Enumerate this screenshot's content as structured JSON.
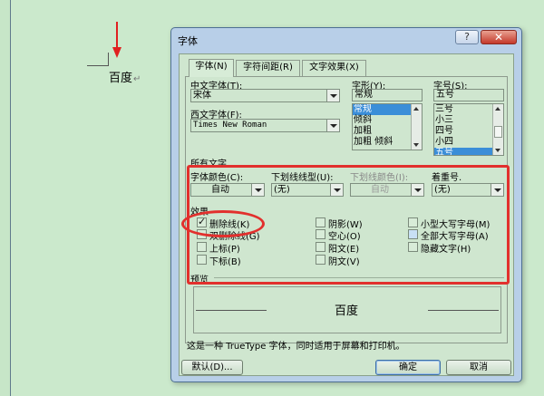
{
  "document": {
    "text": "百度",
    "return_mark": "↵"
  },
  "dialog": {
    "title": "字体",
    "help_label": "?",
    "close_label": "✕",
    "tabs": [
      {
        "label": "字体(N)",
        "active": true
      },
      {
        "label": "字符间距(R)",
        "active": false
      },
      {
        "label": "文字效果(X)",
        "active": false
      }
    ],
    "chinese_font": {
      "label": "中文字体(T):",
      "value": "宋体"
    },
    "western_font": {
      "label": "西文字体(F):",
      "value": "Times New Roman"
    },
    "font_style": {
      "label": "字形(Y):",
      "value": "常规",
      "options": [
        "常规",
        "倾斜",
        "加粗",
        "加粗 倾斜"
      ],
      "selected_index": 0
    },
    "font_size": {
      "label": "字号(S):",
      "value": "五号",
      "options": [
        "三号",
        "小三",
        "四号",
        "小四",
        "五号"
      ],
      "selected_index": 4
    },
    "all_text_title": "所有文字",
    "font_color": {
      "label": "字体颜色(C):",
      "value": "自动"
    },
    "underline_type": {
      "label": "下划线线型(U):",
      "value": "(无)"
    },
    "underline_color": {
      "label": "下划线颜色(I):",
      "value": "自动"
    },
    "emphasis_mark": {
      "label": "着重号.",
      "value": "(无)"
    },
    "effects_title": "效果",
    "effects": {
      "strikethrough": {
        "label": "删除线(K)",
        "checked": true
      },
      "double_strikethrough": {
        "label": "双删除线(G)",
        "checked": false
      },
      "superscript": {
        "label": "上标(P)",
        "checked": false
      },
      "subscript": {
        "label": "下标(B)",
        "checked": false
      },
      "shadow": {
        "label": "阴影(W)",
        "checked": false
      },
      "outline": {
        "label": "空心(O)",
        "checked": false
      },
      "emboss": {
        "label": "阳文(E)",
        "checked": false
      },
      "engrave": {
        "label": "阴文(V)",
        "checked": false
      },
      "small_caps": {
        "label": "小型大写字母(M)",
        "checked": false
      },
      "all_caps": {
        "label": "全部大写字母(A)",
        "checked": false
      },
      "hidden": {
        "label": "隐藏文字(H)",
        "checked": false
      }
    },
    "preview_title": "预览",
    "preview_text": "百度",
    "description": "这是一种 TrueType 字体，同时适用于屏幕和打印机。",
    "buttons": {
      "default": "默认(D)...",
      "ok": "确定",
      "cancel": "取消"
    }
  },
  "colors": {
    "background": "#c9e8c9",
    "annotation_red": "#e2302d",
    "selection_blue": "#3b8ed8"
  }
}
